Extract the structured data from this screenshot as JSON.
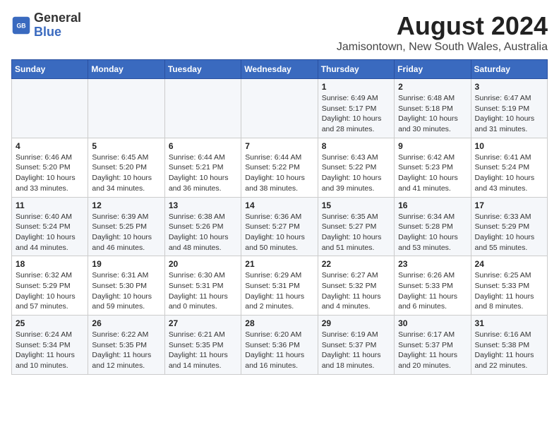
{
  "logo": {
    "name": "General",
    "name2": "Blue"
  },
  "title": "August 2024",
  "subtitle": "Jamisontown, New South Wales, Australia",
  "weekdays": [
    "Sunday",
    "Monday",
    "Tuesday",
    "Wednesday",
    "Thursday",
    "Friday",
    "Saturday"
  ],
  "weeks": [
    [
      {
        "day": "",
        "info": ""
      },
      {
        "day": "",
        "info": ""
      },
      {
        "day": "",
        "info": ""
      },
      {
        "day": "",
        "info": ""
      },
      {
        "day": "1",
        "info": "Sunrise: 6:49 AM\nSunset: 5:17 PM\nDaylight: 10 hours\nand 28 minutes."
      },
      {
        "day": "2",
        "info": "Sunrise: 6:48 AM\nSunset: 5:18 PM\nDaylight: 10 hours\nand 30 minutes."
      },
      {
        "day": "3",
        "info": "Sunrise: 6:47 AM\nSunset: 5:19 PM\nDaylight: 10 hours\nand 31 minutes."
      }
    ],
    [
      {
        "day": "4",
        "info": "Sunrise: 6:46 AM\nSunset: 5:20 PM\nDaylight: 10 hours\nand 33 minutes."
      },
      {
        "day": "5",
        "info": "Sunrise: 6:45 AM\nSunset: 5:20 PM\nDaylight: 10 hours\nand 34 minutes."
      },
      {
        "day": "6",
        "info": "Sunrise: 6:44 AM\nSunset: 5:21 PM\nDaylight: 10 hours\nand 36 minutes."
      },
      {
        "day": "7",
        "info": "Sunrise: 6:44 AM\nSunset: 5:22 PM\nDaylight: 10 hours\nand 38 minutes."
      },
      {
        "day": "8",
        "info": "Sunrise: 6:43 AM\nSunset: 5:22 PM\nDaylight: 10 hours\nand 39 minutes."
      },
      {
        "day": "9",
        "info": "Sunrise: 6:42 AM\nSunset: 5:23 PM\nDaylight: 10 hours\nand 41 minutes."
      },
      {
        "day": "10",
        "info": "Sunrise: 6:41 AM\nSunset: 5:24 PM\nDaylight: 10 hours\nand 43 minutes."
      }
    ],
    [
      {
        "day": "11",
        "info": "Sunrise: 6:40 AM\nSunset: 5:24 PM\nDaylight: 10 hours\nand 44 minutes."
      },
      {
        "day": "12",
        "info": "Sunrise: 6:39 AM\nSunset: 5:25 PM\nDaylight: 10 hours\nand 46 minutes."
      },
      {
        "day": "13",
        "info": "Sunrise: 6:38 AM\nSunset: 5:26 PM\nDaylight: 10 hours\nand 48 minutes."
      },
      {
        "day": "14",
        "info": "Sunrise: 6:36 AM\nSunset: 5:27 PM\nDaylight: 10 hours\nand 50 minutes."
      },
      {
        "day": "15",
        "info": "Sunrise: 6:35 AM\nSunset: 5:27 PM\nDaylight: 10 hours\nand 51 minutes."
      },
      {
        "day": "16",
        "info": "Sunrise: 6:34 AM\nSunset: 5:28 PM\nDaylight: 10 hours\nand 53 minutes."
      },
      {
        "day": "17",
        "info": "Sunrise: 6:33 AM\nSunset: 5:29 PM\nDaylight: 10 hours\nand 55 minutes."
      }
    ],
    [
      {
        "day": "18",
        "info": "Sunrise: 6:32 AM\nSunset: 5:29 PM\nDaylight: 10 hours\nand 57 minutes."
      },
      {
        "day": "19",
        "info": "Sunrise: 6:31 AM\nSunset: 5:30 PM\nDaylight: 10 hours\nand 59 minutes."
      },
      {
        "day": "20",
        "info": "Sunrise: 6:30 AM\nSunset: 5:31 PM\nDaylight: 11 hours\nand 0 minutes."
      },
      {
        "day": "21",
        "info": "Sunrise: 6:29 AM\nSunset: 5:31 PM\nDaylight: 11 hours\nand 2 minutes."
      },
      {
        "day": "22",
        "info": "Sunrise: 6:27 AM\nSunset: 5:32 PM\nDaylight: 11 hours\nand 4 minutes."
      },
      {
        "day": "23",
        "info": "Sunrise: 6:26 AM\nSunset: 5:33 PM\nDaylight: 11 hours\nand 6 minutes."
      },
      {
        "day": "24",
        "info": "Sunrise: 6:25 AM\nSunset: 5:33 PM\nDaylight: 11 hours\nand 8 minutes."
      }
    ],
    [
      {
        "day": "25",
        "info": "Sunrise: 6:24 AM\nSunset: 5:34 PM\nDaylight: 11 hours\nand 10 minutes."
      },
      {
        "day": "26",
        "info": "Sunrise: 6:22 AM\nSunset: 5:35 PM\nDaylight: 11 hours\nand 12 minutes."
      },
      {
        "day": "27",
        "info": "Sunrise: 6:21 AM\nSunset: 5:35 PM\nDaylight: 11 hours\nand 14 minutes."
      },
      {
        "day": "28",
        "info": "Sunrise: 6:20 AM\nSunset: 5:36 PM\nDaylight: 11 hours\nand 16 minutes."
      },
      {
        "day": "29",
        "info": "Sunrise: 6:19 AM\nSunset: 5:37 PM\nDaylight: 11 hours\nand 18 minutes."
      },
      {
        "day": "30",
        "info": "Sunrise: 6:17 AM\nSunset: 5:37 PM\nDaylight: 11 hours\nand 20 minutes."
      },
      {
        "day": "31",
        "info": "Sunrise: 6:16 AM\nSunset: 5:38 PM\nDaylight: 11 hours\nand 22 minutes."
      }
    ]
  ]
}
